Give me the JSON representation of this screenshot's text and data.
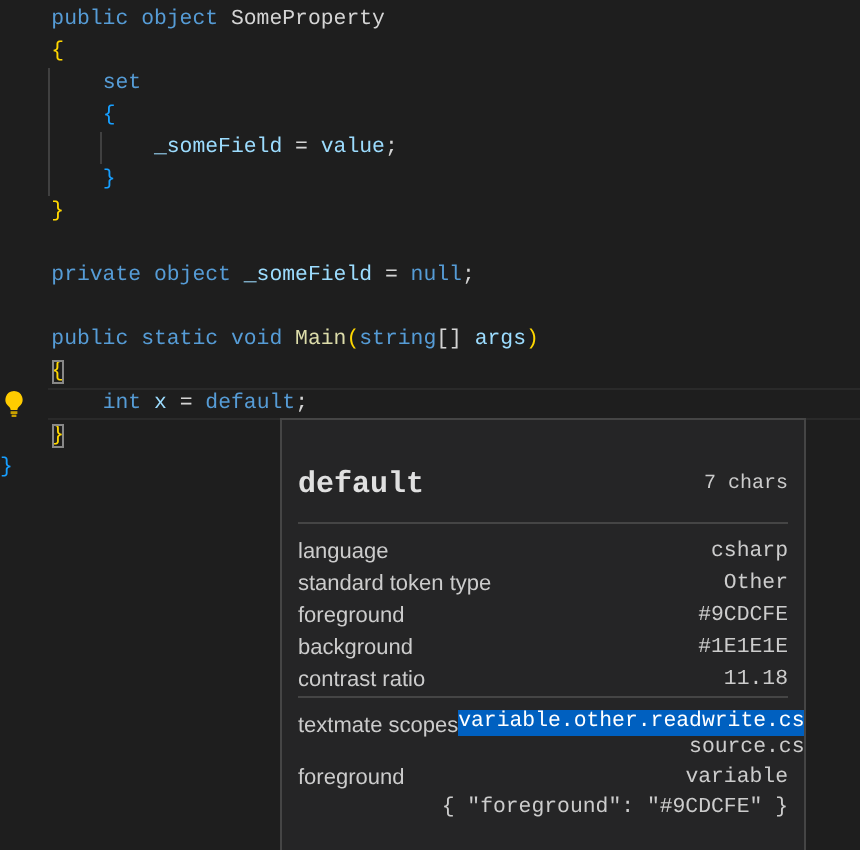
{
  "editor": {
    "lines": [
      {
        "current": false,
        "tokens": [
          {
            "text": "    public",
            "kind": "keyword"
          },
          {
            "text": " object",
            "kind": "keyword"
          },
          {
            "text": " SomeProperty",
            "kind": "plain"
          }
        ]
      },
      {
        "current": false,
        "tokens": [
          {
            "text": "    {",
            "kind": "bracket-gold",
            "matched": false
          }
        ]
      },
      {
        "current": false,
        "tokens": [
          {
            "text": "        set",
            "kind": "keyword"
          }
        ]
      },
      {
        "current": false,
        "tokens": [
          {
            "text": "        {",
            "kind": "bracket-blue",
            "matched": false
          }
        ]
      },
      {
        "current": false,
        "tokens": [
          {
            "text": "            _someField",
            "kind": "variable"
          },
          {
            "text": " =",
            "kind": "plain"
          },
          {
            "text": " value",
            "kind": "variable"
          },
          {
            "text": ";",
            "kind": "plain"
          }
        ]
      },
      {
        "current": false,
        "tokens": [
          {
            "text": "        }",
            "kind": "bracket-blue",
            "matched": false
          }
        ]
      },
      {
        "current": false,
        "tokens": [
          {
            "text": "    }",
            "kind": "bracket-gold",
            "matched": false
          }
        ]
      },
      {
        "current": false
      },
      {
        "current": false,
        "tokens": [
          {
            "text": "    private",
            "kind": "keyword"
          },
          {
            "text": " object",
            "kind": "keyword"
          },
          {
            "text": " _someField",
            "kind": "variable"
          },
          {
            "text": " =",
            "kind": "plain"
          },
          {
            "text": " null",
            "kind": "keyword"
          },
          {
            "text": ";",
            "kind": "plain"
          }
        ]
      },
      {
        "current": false
      },
      {
        "current": false,
        "tokens": [
          {
            "text": "    public",
            "kind": "keyword"
          },
          {
            "text": " static",
            "kind": "keyword"
          },
          {
            "text": " void",
            "kind": "keyword"
          },
          {
            "text": " Main",
            "kind": "function"
          },
          {
            "text": "(",
            "kind": "bracket-gold",
            "matched": false
          },
          {
            "text": "string",
            "kind": "keyword"
          },
          {
            "text": "[]",
            "kind": "plain"
          },
          {
            "text": " args",
            "kind": "variable"
          },
          {
            "text": ")",
            "kind": "bracket-gold",
            "matched": false
          }
        ]
      },
      {
        "current": false,
        "tokens": [
          {
            "text": "    {",
            "kind": "bracket-gold",
            "matched": true
          }
        ]
      },
      {
        "current": true,
        "tokens": [
          {
            "text": "        int",
            "kind": "keyword"
          },
          {
            "text": " x",
            "kind": "variable"
          },
          {
            "text": " =",
            "kind": "plain"
          },
          {
            "text": " default",
            "kind": "keyword"
          },
          {
            "text": ";",
            "kind": "plain"
          }
        ]
      },
      {
        "current": false,
        "tokens": [
          {
            "text": "    }",
            "kind": "bracket-gold",
            "matched": true
          }
        ]
      },
      {
        "current": false,
        "tokens": [
          {
            "text": "}",
            "kind": "bracket-blue",
            "matched": false
          }
        ]
      }
    ]
  },
  "hover": {
    "token": "default",
    "length": "7 chars",
    "rows": [
      {
        "label": "language",
        "value": "csharp"
      },
      {
        "label": "standard token type",
        "value": "Other"
      },
      {
        "label": "foreground",
        "value": "#9CDCFE"
      },
      {
        "label": "background",
        "value": "#1E1E1E"
      },
      {
        "label": "contrast ratio",
        "value": "11.18"
      }
    ],
    "scopes_label": "textmate scopes",
    "scopes": [
      {
        "text": "variable.other.readwrite.cs",
        "selected": true
      },
      {
        "text": "source.cs",
        "selected": false
      }
    ],
    "theme_label": "foreground",
    "theme_rule": "variable",
    "theme_value": "{ \"foreground\": \"#9CDCFE\" }"
  }
}
